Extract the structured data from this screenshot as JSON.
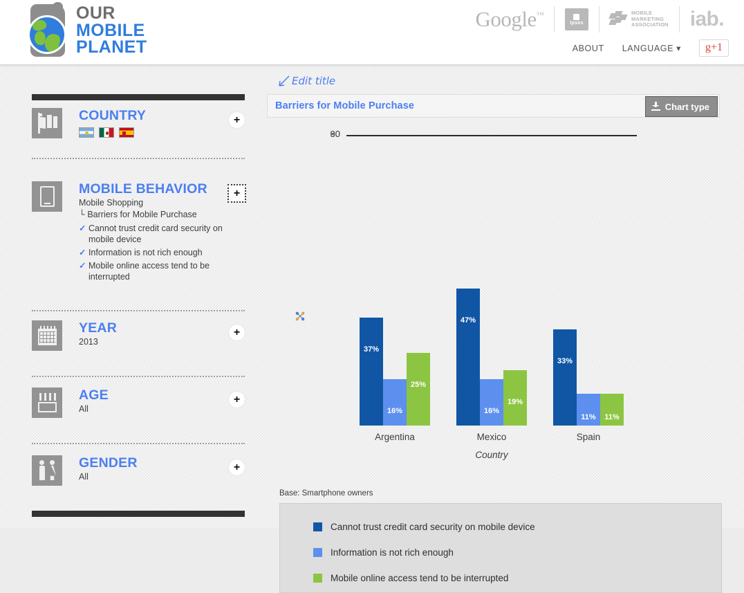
{
  "header": {
    "logo": {
      "line1": "OUR",
      "line2": "MOBILE",
      "line3": "PLANET",
      "icon": "globe-phone-logo"
    },
    "partners": [
      {
        "name": "google-logo",
        "text": "Google"
      },
      {
        "name": "ipsos-logo",
        "text": "Ipsos"
      },
      {
        "name": "mobile-marketing-association-logo",
        "line1": "MOBILE",
        "line2": "MARKETING",
        "line3": "ASSOCIATION"
      },
      {
        "name": "iab-logo",
        "text": "iab."
      }
    ],
    "nav": {
      "about": "ABOUT",
      "language": "LANGUAGE ▾",
      "gplus": "g+1"
    }
  },
  "sidebar": {
    "facets": [
      {
        "id": "country",
        "title": "COUNTRY",
        "icon": "flags-icon",
        "plus": "+",
        "flags": [
          "Argentina",
          "Mexico",
          "Spain"
        ]
      },
      {
        "id": "mobile-behavior",
        "title": "MOBILE BEHAVIOR",
        "icon": "mobile-device-icon",
        "plus": "+",
        "sub": "Mobile Shopping",
        "tree": "└ Barriers for Mobile Purchase",
        "checks": [
          "Cannot trust credit card security on mobile device",
          "Information is not rich enough",
          "Mobile online access tend to be interrupted"
        ]
      },
      {
        "id": "year",
        "title": "YEAR",
        "icon": "calendar-icon",
        "plus": "+",
        "sub": "2013"
      },
      {
        "id": "age",
        "title": "AGE",
        "icon": "age-icon",
        "plus": "+",
        "sub": "All"
      },
      {
        "id": "gender",
        "title": "GENDER",
        "icon": "gender-icon",
        "plus": "+",
        "sub": "All"
      }
    ]
  },
  "main": {
    "edit_title_note": "Edit title",
    "chart_title": "Barriers for Mobile Purchase",
    "chart_type_button": "Chart type",
    "chart_type_icon": "download-icon",
    "drag_handle_icon": "move-handle-icon",
    "base_note": "Base: Smartphone owners"
  },
  "chart_data": {
    "type": "bar",
    "title": "Barriers for Mobile Purchase",
    "xlabel": "Country",
    "ylabel": "",
    "categories": [
      "Argentina",
      "Mexico",
      "Spain"
    ],
    "ylim": [
      0,
      90
    ],
    "yticks": [
      0,
      30,
      60,
      90
    ],
    "grid": true,
    "legend_position": "bottom",
    "value_suffix": "%",
    "series": [
      {
        "name": "Cannot trust credit card security on mobile device",
        "color": "#1056a4",
        "values": [
          37,
          47,
          33
        ],
        "labels": [
          "37%",
          "47%",
          "33%"
        ]
      },
      {
        "name": "Information is not rich enough",
        "color": "#5d8fee",
        "values": [
          16,
          16,
          11
        ],
        "labels": [
          "16%",
          "16%",
          "11%"
        ]
      },
      {
        "name": "Mobile online access tend to be interrupted",
        "color": "#8cc542",
        "values": [
          25,
          19,
          11
        ],
        "labels": [
          "25%",
          "19%",
          "11%"
        ]
      }
    ]
  }
}
